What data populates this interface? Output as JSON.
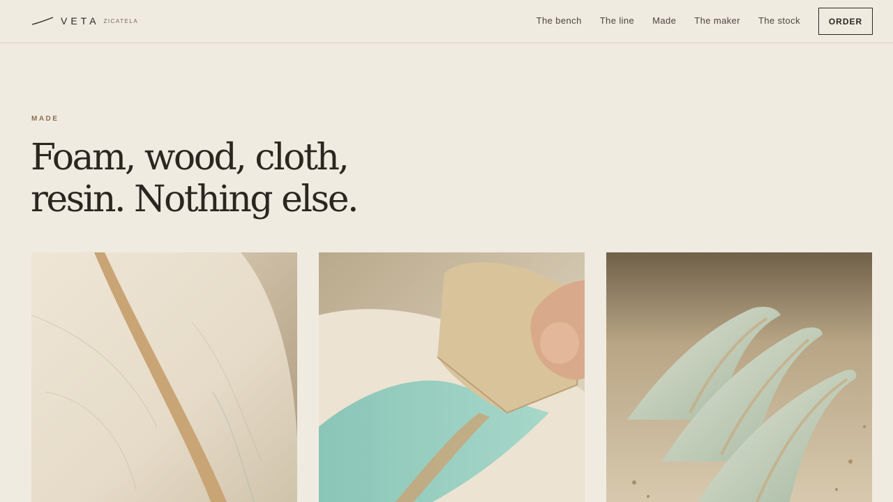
{
  "brand": {
    "name": "VETA",
    "sub": "ZICATELA",
    "logo_icon": "wave-line-icon"
  },
  "nav": {
    "items": [
      {
        "label": "The bench"
      },
      {
        "label": "The line"
      },
      {
        "label": "Made"
      },
      {
        "label": "The maker"
      },
      {
        "label": "The stock"
      }
    ],
    "order_label": "ORDER"
  },
  "hero": {
    "eyebrow": "MADE",
    "headline_line1": "Foam, wood, cloth,",
    "headline_line2": "resin. Nothing else."
  },
  "gallery": {
    "images": [
      {
        "name": "foam-blank-stringer-image"
      },
      {
        "name": "resin-squeegee-image"
      },
      {
        "name": "fins-image"
      }
    ]
  },
  "colors": {
    "background": "#f0ebe1",
    "text": "#2a2620",
    "accent": "#8b6f4e"
  }
}
